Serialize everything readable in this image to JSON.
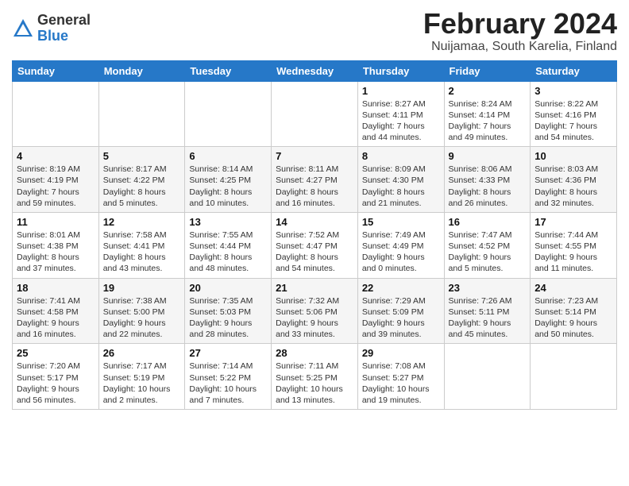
{
  "header": {
    "logo_general": "General",
    "logo_blue": "Blue",
    "title": "February 2024",
    "subtitle": "Nuijamaa, South Karelia, Finland"
  },
  "columns": [
    "Sunday",
    "Monday",
    "Tuesday",
    "Wednesday",
    "Thursday",
    "Friday",
    "Saturday"
  ],
  "weeks": [
    [
      {
        "day": "",
        "detail": ""
      },
      {
        "day": "",
        "detail": ""
      },
      {
        "day": "",
        "detail": ""
      },
      {
        "day": "",
        "detail": ""
      },
      {
        "day": "1",
        "detail": "Sunrise: 8:27 AM\nSunset: 4:11 PM\nDaylight: 7 hours\nand 44 minutes."
      },
      {
        "day": "2",
        "detail": "Sunrise: 8:24 AM\nSunset: 4:14 PM\nDaylight: 7 hours\nand 49 minutes."
      },
      {
        "day": "3",
        "detail": "Sunrise: 8:22 AM\nSunset: 4:16 PM\nDaylight: 7 hours\nand 54 minutes."
      }
    ],
    [
      {
        "day": "4",
        "detail": "Sunrise: 8:19 AM\nSunset: 4:19 PM\nDaylight: 7 hours\nand 59 minutes."
      },
      {
        "day": "5",
        "detail": "Sunrise: 8:17 AM\nSunset: 4:22 PM\nDaylight: 8 hours\nand 5 minutes."
      },
      {
        "day": "6",
        "detail": "Sunrise: 8:14 AM\nSunset: 4:25 PM\nDaylight: 8 hours\nand 10 minutes."
      },
      {
        "day": "7",
        "detail": "Sunrise: 8:11 AM\nSunset: 4:27 PM\nDaylight: 8 hours\nand 16 minutes."
      },
      {
        "day": "8",
        "detail": "Sunrise: 8:09 AM\nSunset: 4:30 PM\nDaylight: 8 hours\nand 21 minutes."
      },
      {
        "day": "9",
        "detail": "Sunrise: 8:06 AM\nSunset: 4:33 PM\nDaylight: 8 hours\nand 26 minutes."
      },
      {
        "day": "10",
        "detail": "Sunrise: 8:03 AM\nSunset: 4:36 PM\nDaylight: 8 hours\nand 32 minutes."
      }
    ],
    [
      {
        "day": "11",
        "detail": "Sunrise: 8:01 AM\nSunset: 4:38 PM\nDaylight: 8 hours\nand 37 minutes."
      },
      {
        "day": "12",
        "detail": "Sunrise: 7:58 AM\nSunset: 4:41 PM\nDaylight: 8 hours\nand 43 minutes."
      },
      {
        "day": "13",
        "detail": "Sunrise: 7:55 AM\nSunset: 4:44 PM\nDaylight: 8 hours\nand 48 minutes."
      },
      {
        "day": "14",
        "detail": "Sunrise: 7:52 AM\nSunset: 4:47 PM\nDaylight: 8 hours\nand 54 minutes."
      },
      {
        "day": "15",
        "detail": "Sunrise: 7:49 AM\nSunset: 4:49 PM\nDaylight: 9 hours\nand 0 minutes."
      },
      {
        "day": "16",
        "detail": "Sunrise: 7:47 AM\nSunset: 4:52 PM\nDaylight: 9 hours\nand 5 minutes."
      },
      {
        "day": "17",
        "detail": "Sunrise: 7:44 AM\nSunset: 4:55 PM\nDaylight: 9 hours\nand 11 minutes."
      }
    ],
    [
      {
        "day": "18",
        "detail": "Sunrise: 7:41 AM\nSunset: 4:58 PM\nDaylight: 9 hours\nand 16 minutes."
      },
      {
        "day": "19",
        "detail": "Sunrise: 7:38 AM\nSunset: 5:00 PM\nDaylight: 9 hours\nand 22 minutes."
      },
      {
        "day": "20",
        "detail": "Sunrise: 7:35 AM\nSunset: 5:03 PM\nDaylight: 9 hours\nand 28 minutes."
      },
      {
        "day": "21",
        "detail": "Sunrise: 7:32 AM\nSunset: 5:06 PM\nDaylight: 9 hours\nand 33 minutes."
      },
      {
        "day": "22",
        "detail": "Sunrise: 7:29 AM\nSunset: 5:09 PM\nDaylight: 9 hours\nand 39 minutes."
      },
      {
        "day": "23",
        "detail": "Sunrise: 7:26 AM\nSunset: 5:11 PM\nDaylight: 9 hours\nand 45 minutes."
      },
      {
        "day": "24",
        "detail": "Sunrise: 7:23 AM\nSunset: 5:14 PM\nDaylight: 9 hours\nand 50 minutes."
      }
    ],
    [
      {
        "day": "25",
        "detail": "Sunrise: 7:20 AM\nSunset: 5:17 PM\nDaylight: 9 hours\nand 56 minutes."
      },
      {
        "day": "26",
        "detail": "Sunrise: 7:17 AM\nSunset: 5:19 PM\nDaylight: 10 hours\nand 2 minutes."
      },
      {
        "day": "27",
        "detail": "Sunrise: 7:14 AM\nSunset: 5:22 PM\nDaylight: 10 hours\nand 7 minutes."
      },
      {
        "day": "28",
        "detail": "Sunrise: 7:11 AM\nSunset: 5:25 PM\nDaylight: 10 hours\nand 13 minutes."
      },
      {
        "day": "29",
        "detail": "Sunrise: 7:08 AM\nSunset: 5:27 PM\nDaylight: 10 hours\nand 19 minutes."
      },
      {
        "day": "",
        "detail": ""
      },
      {
        "day": "",
        "detail": ""
      }
    ]
  ]
}
